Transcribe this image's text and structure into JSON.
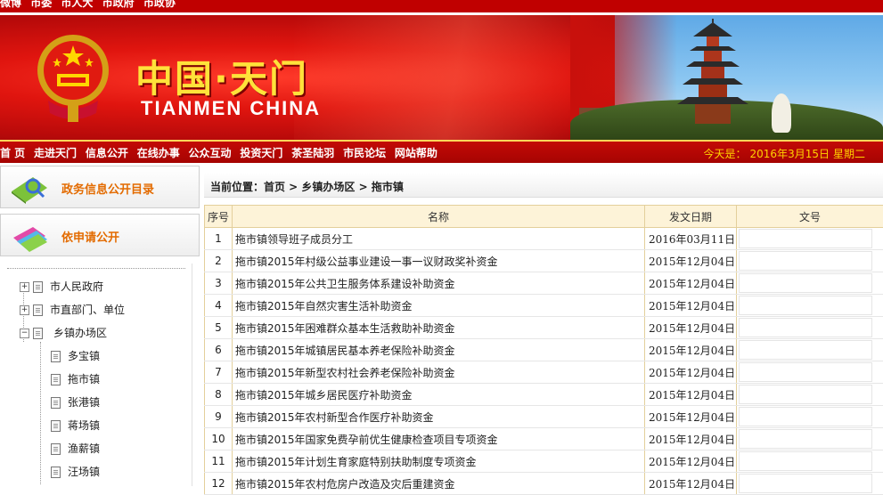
{
  "topbar": {
    "links": [
      "微博",
      "市委",
      "市人大",
      "市政府",
      "市政协"
    ]
  },
  "banner": {
    "title_cn": "中国·天门",
    "title_en": "TIANMEN CHINA"
  },
  "nav": {
    "items": [
      "首 页",
      "走进天门",
      "信息公开",
      "在线办事",
      "公众互动",
      "投资天门",
      "茶圣陆羽",
      "市民论坛",
      "网站帮助"
    ],
    "date_label": "今天是：",
    "date_value": "2016年3月15日",
    "weekday": "星期二"
  },
  "sidebar": {
    "buttons": [
      "政务信息公开目录",
      "依申请公开"
    ],
    "tree": {
      "nodes": [
        {
          "label": "市人民政府",
          "toggle": "+"
        },
        {
          "label": "市直部门、单位",
          "toggle": "+"
        },
        {
          "label": "乡镇办场区",
          "toggle": "−"
        }
      ],
      "children": [
        "多宝镇",
        "拖市镇",
        "张港镇",
        "蒋场镇",
        "渔薪镇",
        "汪场镇"
      ]
    }
  },
  "breadcrumb": {
    "text": "当前位置：首页 > 乡镇办场区 > 拖市镇"
  },
  "table": {
    "headers": [
      "序号",
      "名称",
      "发文日期",
      "文号"
    ],
    "rows": [
      {
        "no": "1",
        "title": "拖市镇领导班子成员分工",
        "date": "2016年03月11日",
        "docno": ""
      },
      {
        "no": "2",
        "title": "拖市镇2015年村级公益事业建设一事一议财政奖补资金",
        "date": "2015年12月04日",
        "docno": ""
      },
      {
        "no": "3",
        "title": "拖市镇2015年公共卫生服务体系建设补助资金",
        "date": "2015年12月04日",
        "docno": ""
      },
      {
        "no": "4",
        "title": "拖市镇2015年自然灾害生活补助资金",
        "date": "2015年12月04日",
        "docno": ""
      },
      {
        "no": "5",
        "title": "拖市镇2015年困难群众基本生活救助补助资金",
        "date": "2015年12月04日",
        "docno": ""
      },
      {
        "no": "6",
        "title": "拖市镇2015年城镇居民基本养老保险补助资金",
        "date": "2015年12月04日",
        "docno": ""
      },
      {
        "no": "7",
        "title": "拖市镇2015年新型农村社会养老保险补助资金",
        "date": "2015年12月04日",
        "docno": ""
      },
      {
        "no": "8",
        "title": "拖市镇2015年城乡居民医疗补助资金",
        "date": "2015年12月04日",
        "docno": ""
      },
      {
        "no": "9",
        "title": "拖市镇2015年农村新型合作医疗补助资金",
        "date": "2015年12月04日",
        "docno": ""
      },
      {
        "no": "10",
        "title": "拖市镇2015年国家免费孕前优生健康检查项目专项资金",
        "date": "2015年12月04日",
        "docno": ""
      },
      {
        "no": "11",
        "title": "拖市镇2015年计划生育家庭特别扶助制度专项资金",
        "date": "2015年12月04日",
        "docno": ""
      },
      {
        "no": "12",
        "title": "拖市镇2015年农村危房户改造及灾后重建资金",
        "date": "2015年12月04日",
        "docno": ""
      }
    ]
  },
  "colors": {
    "brand_red": "#c00000",
    "nav_date": "#ffd200",
    "sidebar_label": "#e36b00",
    "table_header_bg": "#fdf3d8"
  }
}
